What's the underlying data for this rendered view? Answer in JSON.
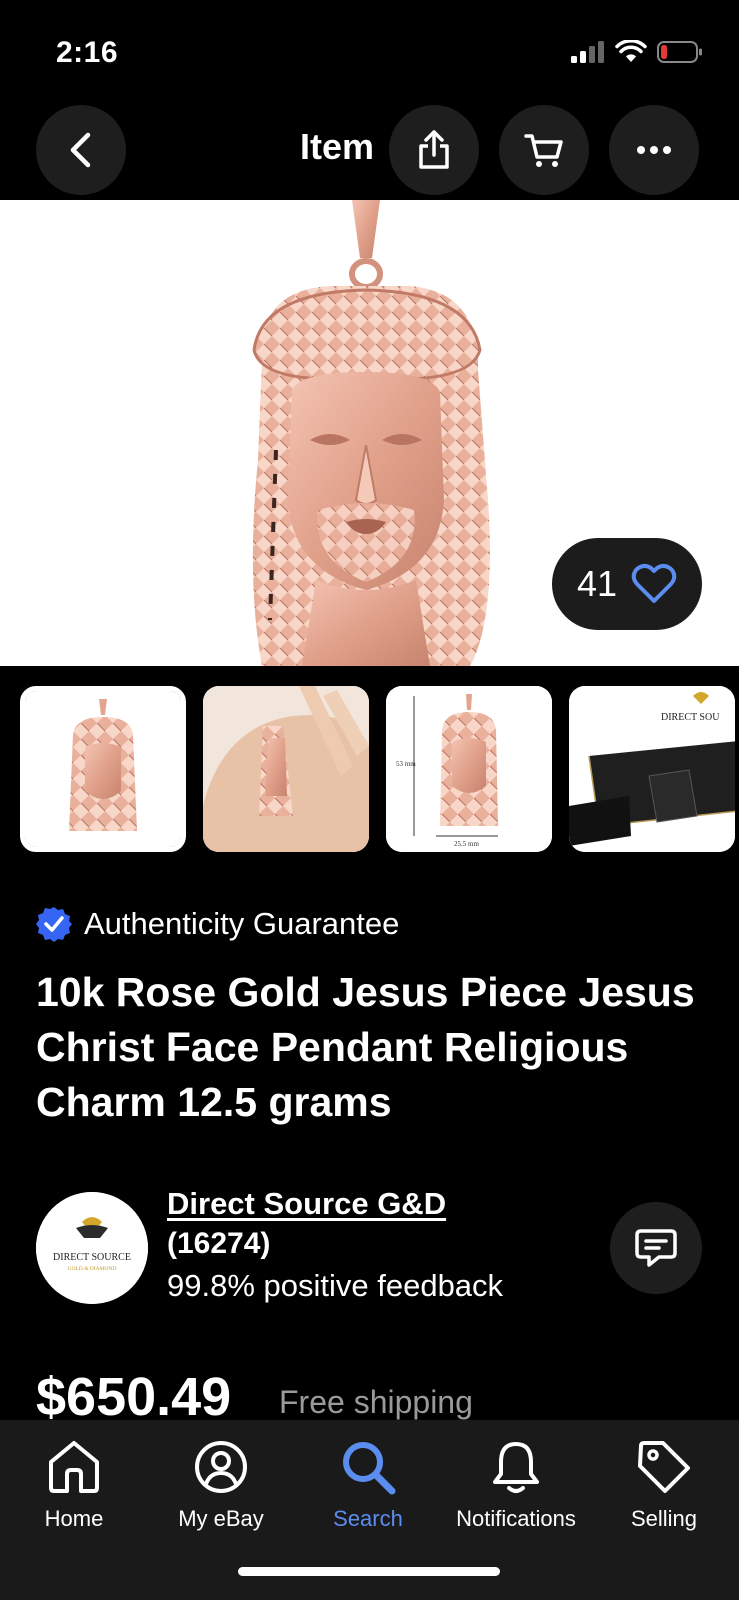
{
  "status_bar": {
    "time": "2:16"
  },
  "header": {
    "title": "Item"
  },
  "listing": {
    "watch_count": "41",
    "authenticity_label": "Authenticity Guarantee",
    "title": "10k Rose Gold Jesus Piece Jesus Christ Face Pendant Religious Charm 12.5 grams",
    "price": "$650.49",
    "shipping": "Free shipping"
  },
  "thumbnails": {
    "dim_height": "53 mm",
    "dim_width": "25.5 mm",
    "brand_text": "DIRECT SOU"
  },
  "seller": {
    "name": "Direct Source G&D",
    "score": "(16274)",
    "feedback": "99.8% positive feedback",
    "logo_text": "DIRECT SOURCE",
    "logo_subtext": "GOLD & DIAMOND"
  },
  "tabbar": {
    "items": [
      {
        "label": "Home",
        "icon": "home-icon"
      },
      {
        "label": "My eBay",
        "icon": "user-icon"
      },
      {
        "label": "Search",
        "icon": "search-icon"
      },
      {
        "label": "Notifications",
        "icon": "bell-icon"
      },
      {
        "label": "Selling",
        "icon": "tag-icon"
      }
    ],
    "active": "Search"
  },
  "colors": {
    "accent": "#5b8def",
    "verified": "#3665f3",
    "rose_gold": "#e8a895",
    "low_battery": "#e53935"
  }
}
